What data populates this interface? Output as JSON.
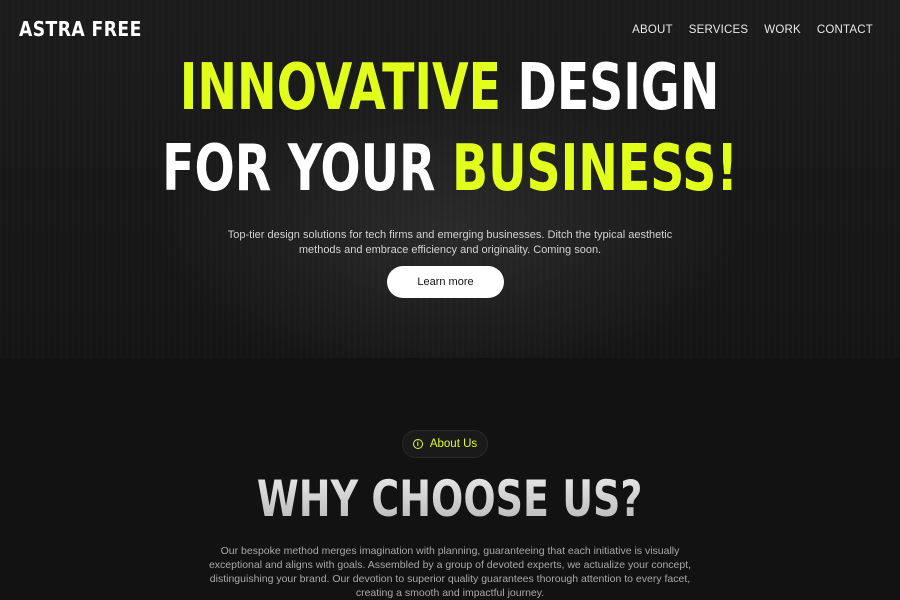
{
  "header": {
    "logo": "ASTRA FREE",
    "nav": [
      "ABOUT",
      "SERVICES",
      "WORK",
      "CONTACT"
    ]
  },
  "hero": {
    "line1_accent": "INNOVATIVE",
    "line1_rest": "DESIGN",
    "line2_rest": "FOR YOUR",
    "line2_accent": "BUSINESS!",
    "subtitle": "Top-tier design solutions for tech firms and emerging businesses. Ditch the typical aesthetic methods and embrace efficiency and originality. Coming soon.",
    "cta_label": "Learn more"
  },
  "about": {
    "pill_label": "About Us",
    "pill_icon": "info-circle-icon",
    "heading": "WHY CHOOSE US?",
    "body": "Our bespoke method merges imagination with planning, guaranteeing that each initiative is visually exceptional and aligns with goals. Assembled by a group of devoted experts, we actualize your concept, distinguishing your brand. Our devotion to superior quality guarantees thorough attention to every facet, creating a smooth and impactful journey."
  },
  "colors": {
    "accent": "#e1ff1a",
    "background": "#121212",
    "text": "#ffffff"
  }
}
